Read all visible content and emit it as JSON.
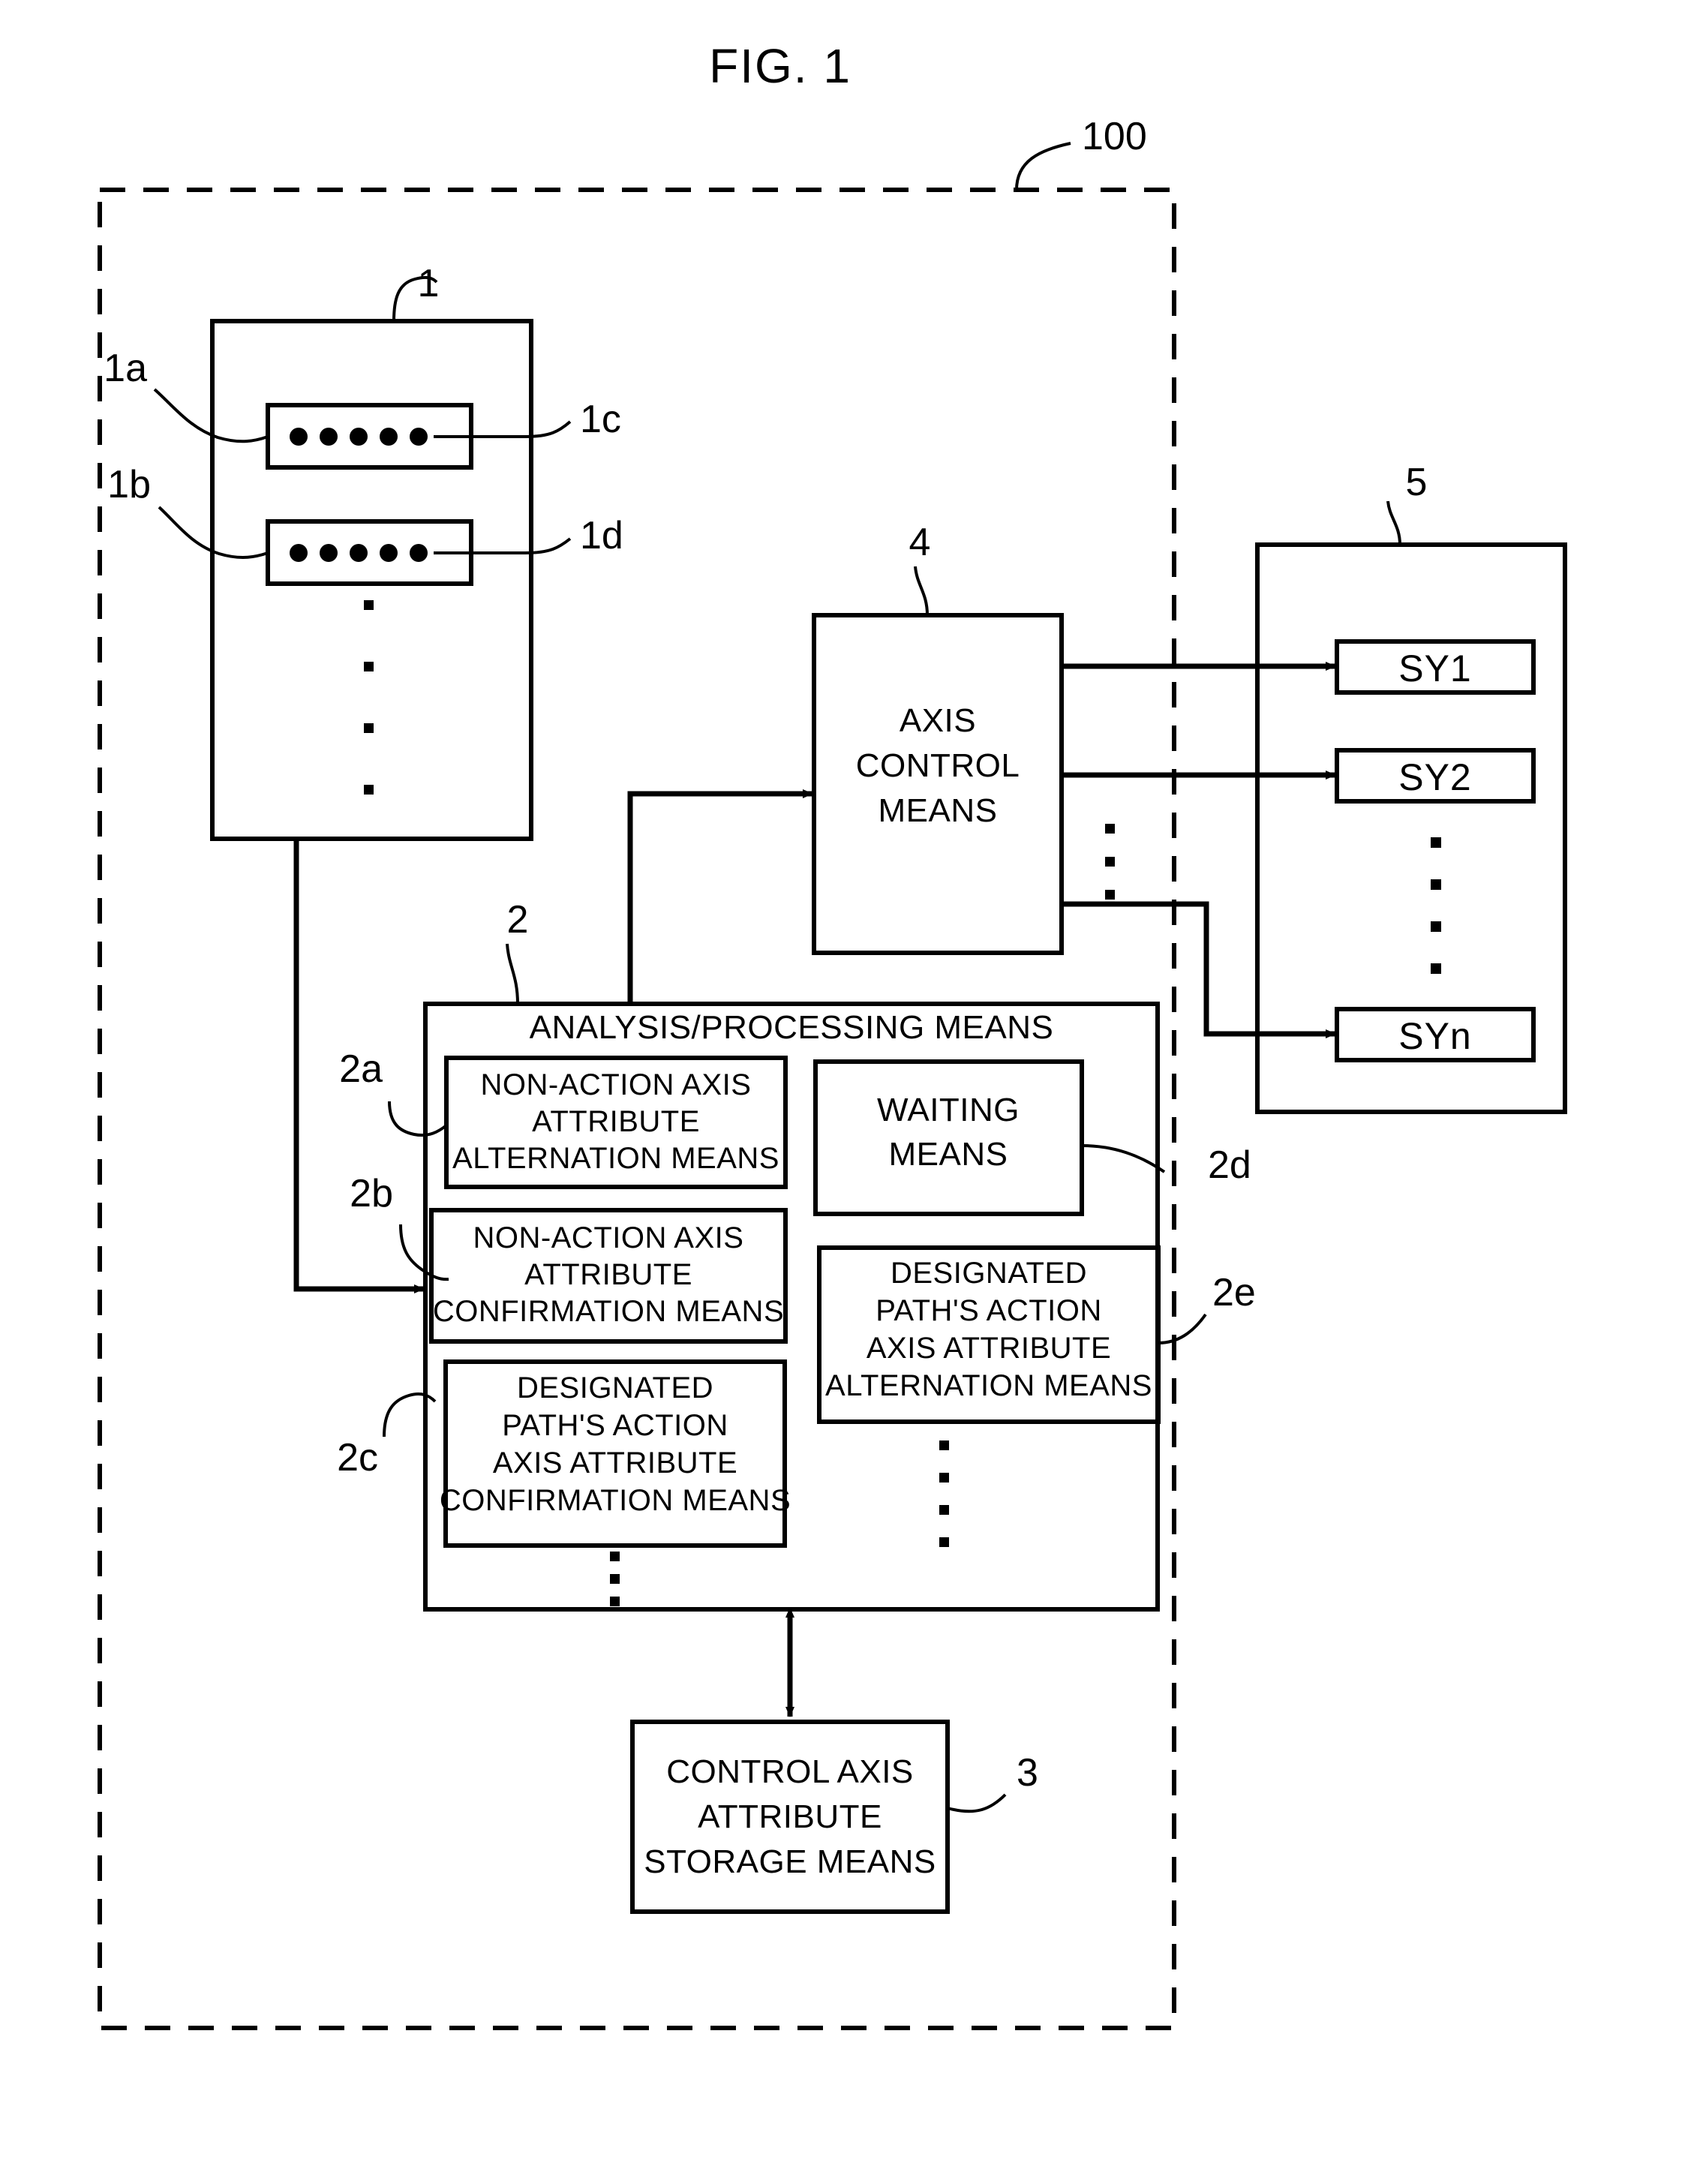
{
  "figure": {
    "title": "FIG. 1",
    "system_ref": "100"
  },
  "refs": {
    "r1": "1",
    "r1a": "1a",
    "r1b": "1b",
    "r1c": "1c",
    "r1d": "1d",
    "r2": "2",
    "r2a": "2a",
    "r2b": "2b",
    "r2c": "2c",
    "r2d": "2d",
    "r2e": "2e",
    "r3": "3",
    "r4": "4",
    "r5": "5",
    "r100": "100"
  },
  "blocks": {
    "program_block": {
      "ref": "1",
      "rows": [
        {
          "ref_left": "1a",
          "ref_right": "1c",
          "dots": 5
        },
        {
          "ref_left": "1b",
          "ref_right": "1d",
          "dots": 5
        }
      ]
    },
    "axis_control_means": {
      "ref": "4",
      "lines": [
        "AXIS",
        "CONTROL",
        "MEANS"
      ]
    },
    "servo_group": {
      "ref": "5",
      "items": [
        "SY1",
        "SY2",
        "SYn"
      ]
    },
    "analysis_processing_means": {
      "ref": "2",
      "title": "ANALYSIS/PROCESSING MEANS",
      "sub_blocks": [
        {
          "ref": "2a",
          "lines": [
            "NON-ACTION AXIS",
            "ATTRIBUTE",
            "ALTERNATION MEANS"
          ]
        },
        {
          "ref": "2d",
          "lines": [
            "WAITING",
            "MEANS"
          ]
        },
        {
          "ref": "2b",
          "lines": [
            "NON-ACTION AXIS",
            "ATTRIBUTE",
            "CONFIRMATION MEANS"
          ]
        },
        {
          "ref": "2e",
          "lines": [
            "DESIGNATED",
            "PATH'S ACTION",
            "AXIS ATTRIBUTE",
            "ALTERNATION MEANS"
          ]
        },
        {
          "ref": "2c",
          "lines": [
            "DESIGNATED",
            "PATH'S ACTION",
            "AXIS ATTRIBUTE",
            "CONFIRMATION MEANS"
          ]
        }
      ]
    },
    "control_axis_attribute_storage_means": {
      "ref": "3",
      "lines": [
        "CONTROL AXIS",
        "ATTRIBUTE",
        "STORAGE MEANS"
      ]
    }
  },
  "colors": {
    "stroke": "#000000",
    "background": "#ffffff"
  }
}
